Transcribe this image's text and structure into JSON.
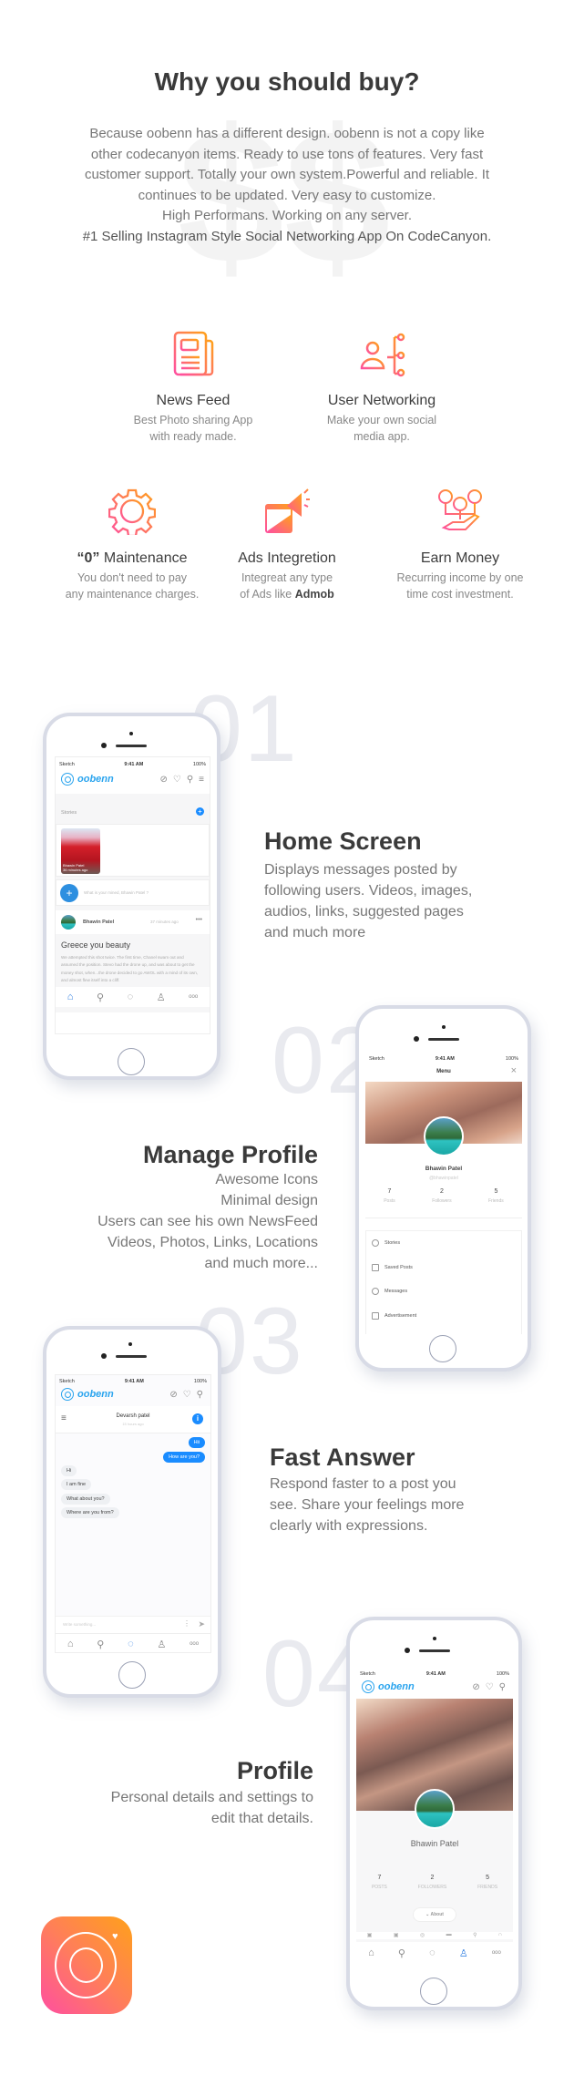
{
  "intro": {
    "title": "Why you should buy?",
    "watermark": "$$",
    "lines": [
      "Because oobenn has a different design. oobenn is not a copy like",
      "other codecanyon items. Ready to use tons of features. Very fast",
      "customer support. Totally your own system.Powerful and reliable. It",
      "continues to be updated. Very easy to customize.",
      "High Performans. Working on any server."
    ],
    "highlight": "#1 Selling Instagram Style Social Networking App On CodeCanyon."
  },
  "features": [
    {
      "icon": "newspaper-icon",
      "title": "News Feed",
      "desc1": "Best Photo sharing App",
      "desc2": "with ready made."
    },
    {
      "icon": "user-network-icon",
      "title": "User Networking",
      "desc1": "Make your own social",
      "desc2": "media app."
    },
    {
      "icon": "gear-icon",
      "title_quote": "“0”",
      "title": " Maintenance",
      "desc1": "You don't need to pay",
      "desc2": "any maintenance charges."
    },
    {
      "icon": "megaphone-icon",
      "title": "Ads Integretion",
      "desc1": "Integreat any type",
      "desc2": "of Ads like ",
      "desc2_bold": "Admob"
    },
    {
      "icon": "money-hand-icon",
      "title": "Earn Money",
      "desc1": "Recurring income by one",
      "desc2": "time cost investment."
    }
  ],
  "colors": {
    "gradient_start": "#ff4fa0",
    "gradient_end": "#ffa11a",
    "accent_blue": "#1a8cff",
    "numeral": "#e9eaef"
  },
  "sections": [
    {
      "num": "01",
      "title": "Home Screen",
      "lines": [
        "Displays messages posted by",
        "following users. Videos, images,",
        "audios, links, suggested pages",
        "and much more"
      ]
    },
    {
      "num": "02",
      "title": "Manage Profile",
      "lines": [
        "Awesome Icons",
        "Minimal design",
        "Users can see his own NewsFeed",
        "Videos, Photos, Links, Locations",
        "and much more..."
      ]
    },
    {
      "num": "03",
      "title": "Fast Answer",
      "lines": [
        "Respond faster to a post  you",
        "see. Share your feelings more",
        "clearly with expressions."
      ]
    },
    {
      "num": "04",
      "title": "Profile",
      "lines": [
        "Personal details and settings to",
        "edit that details."
      ]
    }
  ],
  "phone": {
    "carrier": "Sketch",
    "time": "9:41 AM",
    "battery": "100%",
    "app_name": "oobenn"
  },
  "home": {
    "stories_label": "Stories",
    "story_caption1": "Bhawin Patel",
    "story_caption2": "36 minutes ago",
    "composer_placeholder": "What is your mined, Bhawin Patel ?",
    "post_author": "Bhawin Patel",
    "post_time": "37 minutes ago",
    "post_title": "Greece you beauty",
    "post_body": "We attempted this shot twice. The first time, Chanel swam out and assumed the position. Stevo had the drone up, and was about to get the money shot, when...the drone decided to go AWOL with a mind of its own, and almost flew itself into a cliff."
  },
  "menu": {
    "title": "Menu",
    "name": "Bhawin Patel",
    "handle": "@bhawinpatel",
    "stats": [
      {
        "n": "7",
        "l": "Posts"
      },
      {
        "n": "2",
        "l": "Followers"
      },
      {
        "n": "5",
        "l": "Friends"
      }
    ],
    "items": [
      "Stories",
      "Saved Posts",
      "Messages",
      "Advertisement"
    ]
  },
  "chat": {
    "contact": "Devarsh patel",
    "last_seen": "15 hours ago",
    "sent": [
      "Hii",
      "How are you?"
    ],
    "received": [
      "Hi",
      "I am fine",
      "What about you?",
      "Where are you from?"
    ],
    "input_placeholder": "Write something..."
  },
  "profile": {
    "name": "Bhawin Patel",
    "stats": [
      {
        "n": "7",
        "l": "POSTS"
      },
      {
        "n": "2",
        "l": "FOLLOWERS"
      },
      {
        "n": "5",
        "l": "FRIENDS"
      }
    ],
    "about_label": "About"
  }
}
